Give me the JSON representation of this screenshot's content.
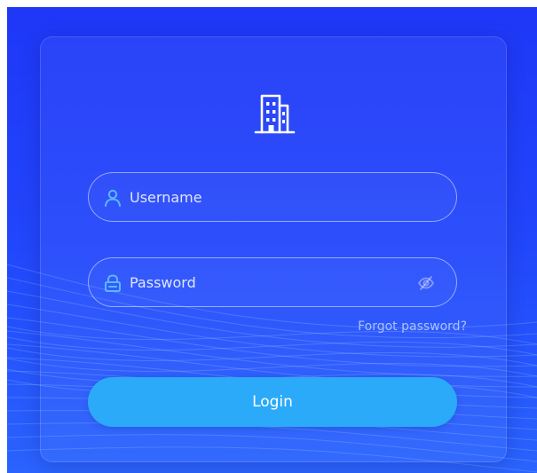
{
  "login_form": {
    "username_placeholder": "Username",
    "password_placeholder": "Password",
    "forgot_password_label": "Forgot password?",
    "login_button_label": "Login"
  },
  "icons": {
    "logo": "building-icon",
    "username": "user-icon",
    "password": "lock-icon",
    "password_visibility": "eye-off-icon"
  },
  "colors": {
    "background": "#2146fb",
    "accent": "#2aaaf8",
    "field_icon": "#5ab8ff",
    "link": "#a9c3ff"
  }
}
